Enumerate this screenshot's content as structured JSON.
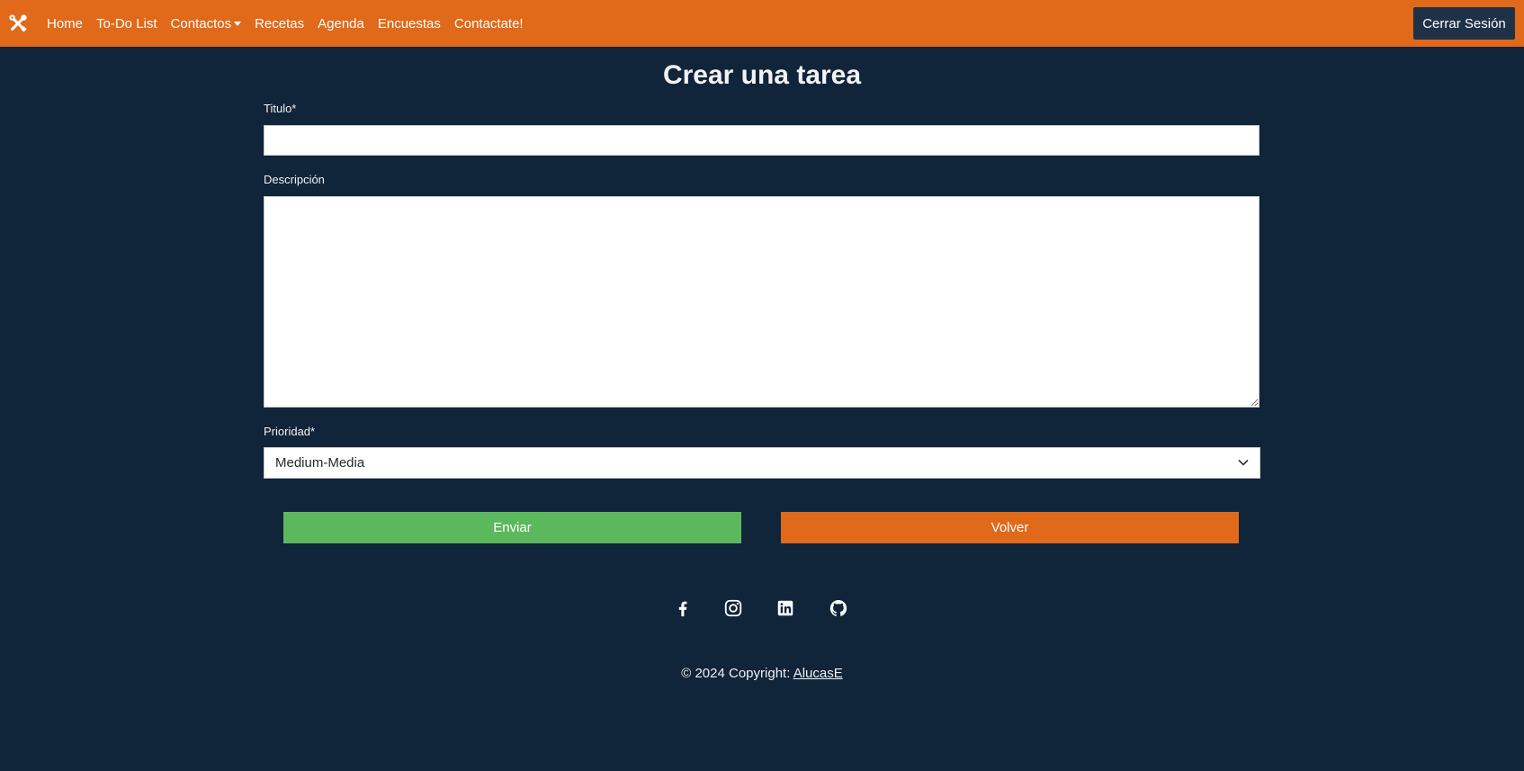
{
  "navbar": {
    "brand_icon": "tools-icon",
    "links": [
      {
        "label": "Home"
      },
      {
        "label": "To-Do List"
      },
      {
        "label": "Contactos"
      },
      {
        "label": "Recetas"
      },
      {
        "label": "Agenda"
      },
      {
        "label": "Encuestas"
      },
      {
        "label": "Contactate!"
      }
    ],
    "logout_label": "Cerrar Sesión"
  },
  "form": {
    "title": "Crear una tarea",
    "titulo_label": "Titulo*",
    "titulo_value": "",
    "descripcion_label": "Descripción",
    "descripcion_value": "",
    "prioridad_label": "Prioridad*",
    "prioridad_selected": "Medium-Media",
    "submit_label": "Enviar",
    "back_label": "Volver"
  },
  "footer": {
    "social": [
      "facebook-icon",
      "instagram-icon",
      "linkedin-icon",
      "github-icon"
    ],
    "copyright_text": "© 2024 Copyright: ",
    "author_link": "AlucasE"
  },
  "colors": {
    "navbar": "#e0691a",
    "background": "#10243a",
    "submit": "#5cb85c",
    "back": "#e0691a",
    "logout": "#1e3147"
  }
}
